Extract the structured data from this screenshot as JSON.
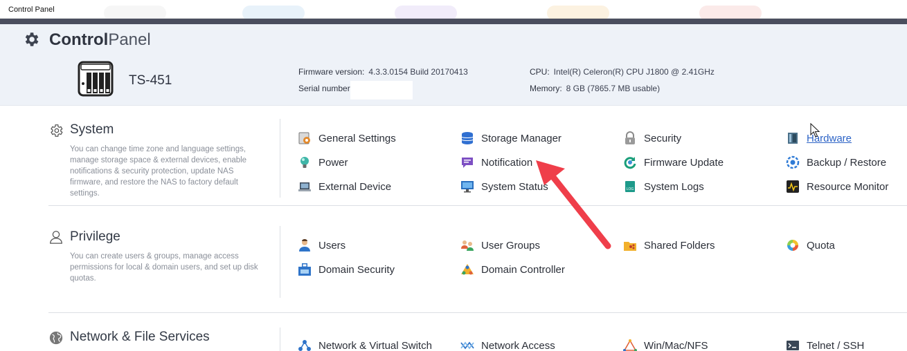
{
  "window": {
    "title": "Control Panel"
  },
  "header": {
    "title_bold": "Control",
    "title_light": "Panel",
    "model": "TS-451",
    "firmware_label": "Firmware version:",
    "firmware_value": "4.3.3.0154 Build 20170413",
    "serial_label": "Serial number",
    "serial_value": "",
    "cpu_label": "CPU:",
    "cpu_value": "Intel(R) Celeron(R) CPU J1800 @ 2.41GHz",
    "memory_label": "Memory:",
    "memory_value": "8 GB (7865.7 MB usable)"
  },
  "sections": [
    {
      "title": "System",
      "icon": "gear-outline-icon",
      "description": "You can change time zone and language settings, manage storage space & external devices, enable notifications & security protection, update NAS firmware, and restore the NAS to factory default settings.",
      "items": [
        {
          "label": "General Settings",
          "icon": "general-settings-icon"
        },
        {
          "label": "Storage Manager",
          "icon": "database-icon"
        },
        {
          "label": "Security",
          "icon": "lock-icon"
        },
        {
          "label": "Hardware",
          "icon": "hardware-icon"
        },
        {
          "label": "Power",
          "icon": "lightbulb-icon"
        },
        {
          "label": "Notification",
          "icon": "chat-bubble-icon"
        },
        {
          "label": "Firmware Update",
          "icon": "refresh-icon"
        },
        {
          "label": "Backup / Restore",
          "icon": "backup-gear-icon"
        },
        {
          "label": "External Device",
          "icon": "laptop-icon"
        },
        {
          "label": "System Status",
          "icon": "monitor-icon"
        },
        {
          "label": "System Logs",
          "icon": "log-file-icon"
        },
        {
          "label": "Resource Monitor",
          "icon": "pulse-icon"
        }
      ]
    },
    {
      "title": "Privilege",
      "icon": "user-outline-icon",
      "description": "You can create users & groups, manage access permissions for local & domain users, and set up disk quotas.",
      "items": [
        {
          "label": "Users",
          "icon": "user-icon"
        },
        {
          "label": "User Groups",
          "icon": "user-group-icon"
        },
        {
          "label": "Shared Folders",
          "icon": "shared-folder-icon"
        },
        {
          "label": "Quota",
          "icon": "quota-pie-icon"
        },
        {
          "label": "Domain Security",
          "icon": "domain-security-icon"
        },
        {
          "label": "Domain Controller",
          "icon": "domain-controller-icon"
        }
      ]
    },
    {
      "title": "Network & File Services",
      "icon": "globe-icon",
      "description": "",
      "items": [
        {
          "label": "Network & Virtual Switch",
          "icon": "network-icon"
        },
        {
          "label": "Network Access",
          "icon": "network-access-icon"
        },
        {
          "label": "Win/Mac/NFS",
          "icon": "triangle-network-icon"
        },
        {
          "label": "Telnet / SSH",
          "icon": "terminal-icon"
        }
      ]
    }
  ],
  "colors": {
    "header_bg": "#eef2f8",
    "title_bar_dark": "#4a4e5e",
    "link": "#2c63c6",
    "annotation_arrow": "#ef3e4a"
  }
}
